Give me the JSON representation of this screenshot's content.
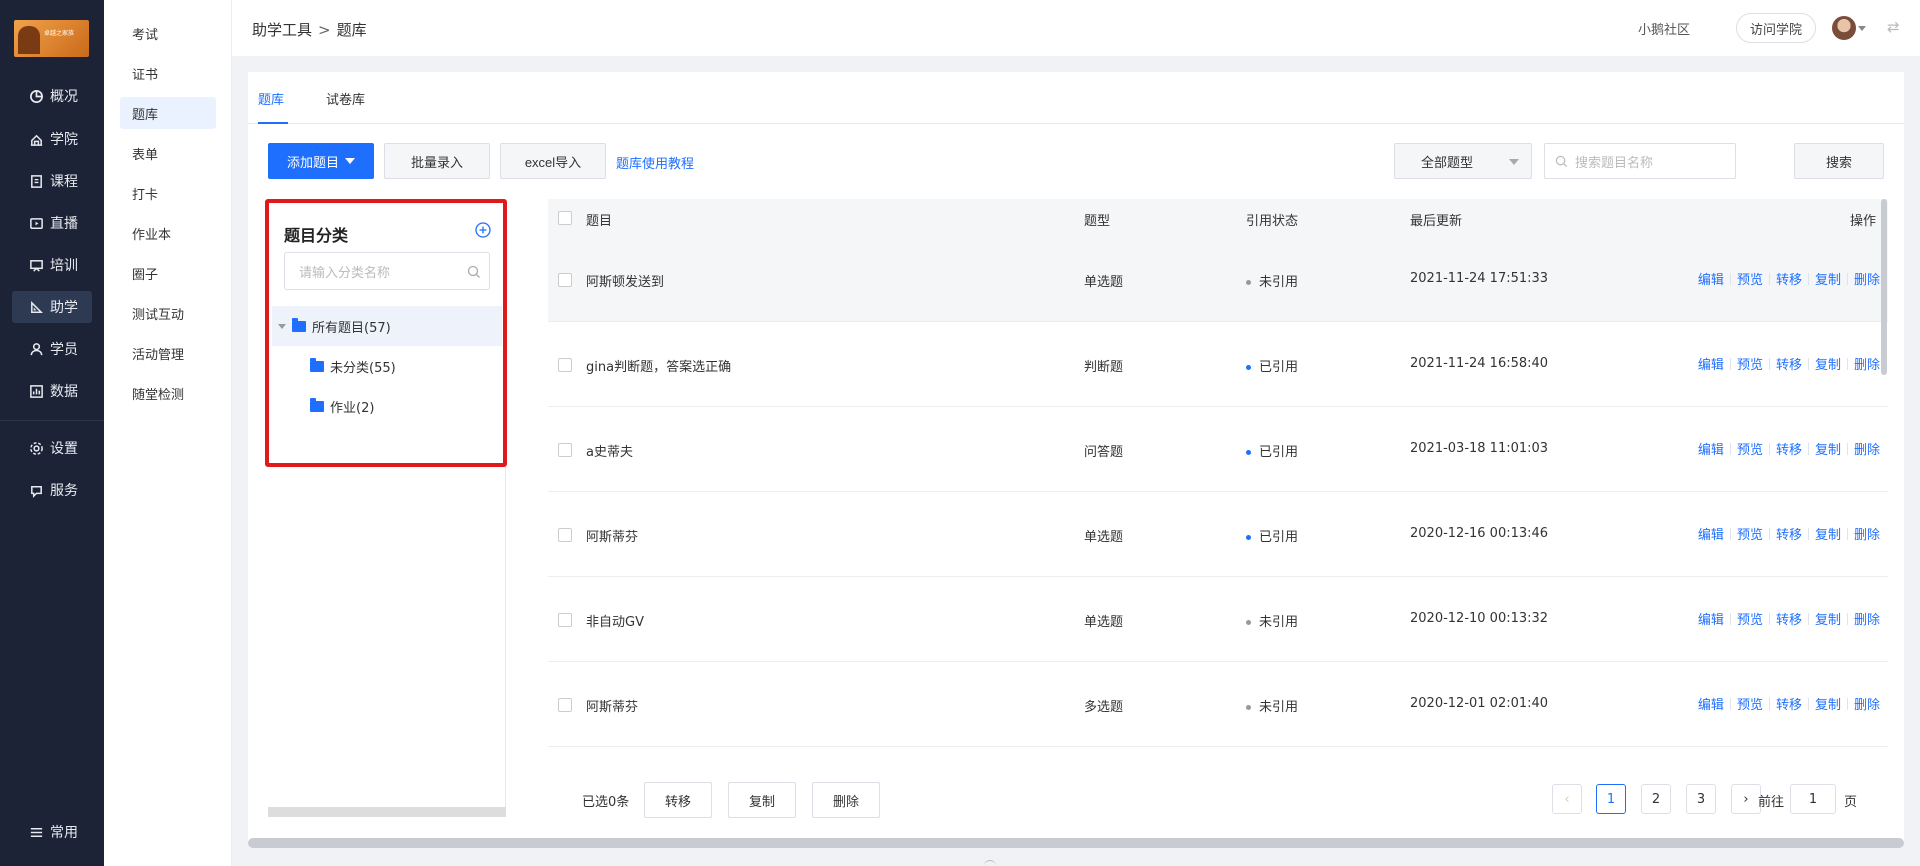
{
  "nav": {
    "logo_text": "卓越之家族",
    "items": [
      {
        "label": "概况",
        "icon": "pie-chart-icon"
      },
      {
        "label": "学院",
        "icon": "academy-icon"
      },
      {
        "label": "课程",
        "icon": "course-icon"
      },
      {
        "label": "直播",
        "icon": "live-icon"
      },
      {
        "label": "培训",
        "icon": "training-icon"
      },
      {
        "label": "助学",
        "icon": "study-aid-icon",
        "active": true
      },
      {
        "label": "学员",
        "icon": "student-icon"
      },
      {
        "label": "数据",
        "icon": "data-icon"
      },
      {
        "label": "设置",
        "icon": "gear-icon"
      },
      {
        "label": "服务",
        "icon": "service-icon"
      }
    ],
    "bottom_label": "常用"
  },
  "subnav": {
    "items": [
      "考试",
      "证书",
      "题库",
      "表单",
      "打卡",
      "作业本",
      "圈子",
      "测试互动",
      "活动管理",
      "随堂检测"
    ],
    "active": "题库"
  },
  "topbar": {
    "breadcrumb": [
      "助学工具",
      "题库"
    ],
    "breadcrumb_sep": ">",
    "community": "小鹅社区",
    "visit": "访问学院"
  },
  "tabs": [
    "题库",
    "试卷库"
  ],
  "toolbar": {
    "add": "添加题目",
    "batch": "批量录入",
    "excel": "excel导入",
    "tutorial": "题库使用教程",
    "type_select": "全部题型",
    "search_placeholder": "搜索题目名称",
    "search_button": "搜索"
  },
  "category": {
    "title": "题目分类",
    "search_placeholder": "请输入分类名称",
    "tree": [
      {
        "label": "所有题目(57)",
        "level": 0
      },
      {
        "label": "未分类(55)",
        "level": 1
      },
      {
        "label": "作业(2)",
        "level": 1
      }
    ]
  },
  "table": {
    "headers": {
      "title": "题目",
      "type": "题型",
      "status": "引用状态",
      "updated": "最后更新",
      "ops": "操作"
    },
    "ops": [
      "编辑",
      "预览",
      "转移",
      "复制",
      "删除"
    ],
    "rows": [
      {
        "title": "阿斯顿发送到",
        "type": "单选题",
        "status": "未引用",
        "cited": false,
        "updated": "2021-11-24 17:51:33"
      },
      {
        "title": "gina判断题，答案选正确",
        "type": "判断题",
        "status": "已引用",
        "cited": true,
        "updated": "2021-11-24 16:58:40"
      },
      {
        "title": "a史蒂夫",
        "type": "问答题",
        "status": "已引用",
        "cited": true,
        "updated": "2021-03-18 11:01:03"
      },
      {
        "title": "阿斯蒂芬",
        "type": "单选题",
        "status": "已引用",
        "cited": true,
        "updated": "2020-12-16 00:13:46"
      },
      {
        "title": "非自动GV",
        "type": "单选题",
        "status": "未引用",
        "cited": false,
        "updated": "2020-12-10 00:13:32"
      },
      {
        "title": "阿斯蒂芬",
        "type": "多选题",
        "status": "未引用",
        "cited": false,
        "updated": "2020-12-01 02:01:40"
      }
    ]
  },
  "footer": {
    "selected": "已选0条",
    "move": "转移",
    "copy": "复制",
    "delete": "删除",
    "pages": [
      "1",
      "2",
      "3"
    ],
    "current_page": "1",
    "goto_label": "前往",
    "goto_value": "1",
    "page_unit": "页"
  },
  "colors": {
    "accent": "#1f6fff",
    "nav_bg": "#1c2336",
    "cited_dot": "#1f6fff",
    "uncited_dot": "#999999"
  }
}
